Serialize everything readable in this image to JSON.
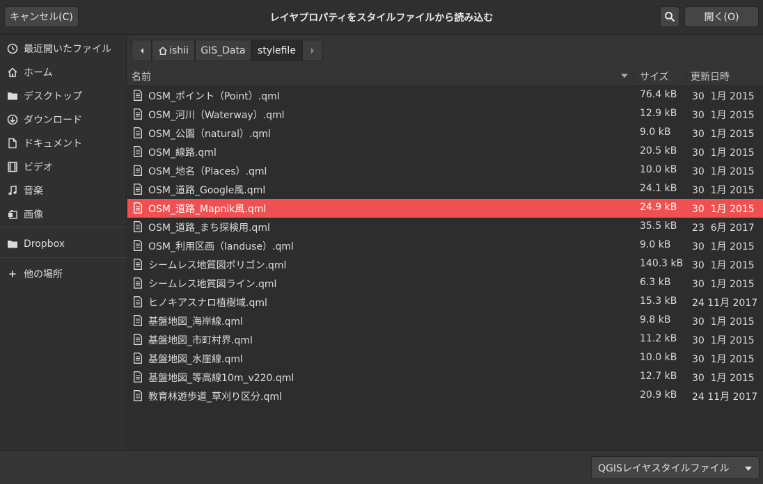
{
  "header": {
    "cancel_label": "キャンセル(C)",
    "title": "レイヤプロパティをスタイルファイルから読み込む",
    "open_label": "開く(O)"
  },
  "sidebar": {
    "items": [
      {
        "label": "最近開いたファイル",
        "icon": "recent-icon"
      },
      {
        "label": "ホーム",
        "icon": "home-icon"
      },
      {
        "label": "デスクトップ",
        "icon": "folder-icon"
      },
      {
        "label": "ダウンロード",
        "icon": "download-icon"
      },
      {
        "label": "ドキュメント",
        "icon": "document-icon"
      },
      {
        "label": "ビデオ",
        "icon": "video-icon"
      },
      {
        "label": "音楽",
        "icon": "music-icon"
      },
      {
        "label": "画像",
        "icon": "image-icon"
      },
      {
        "label": "Dropbox",
        "icon": "folder-icon"
      },
      {
        "label": "他の場所",
        "icon": "plus-icon"
      }
    ]
  },
  "pathbar": {
    "segments": [
      "ishii",
      "GIS_Data",
      "stylefile"
    ],
    "active": "stylefile"
  },
  "columns": {
    "name": "名前",
    "size": "サイズ",
    "modified": "更新日時"
  },
  "files": [
    {
      "name": "OSM_ポイント（Point）.qml",
      "size": "76.4 kB",
      "date": "30  1月 2015"
    },
    {
      "name": "OSM_河川（Waterway）.qml",
      "size": "12.9 kB",
      "date": "30  1月 2015"
    },
    {
      "name": "OSM_公園（natural）.qml",
      "size": "9.0 kB",
      "date": "30  1月 2015"
    },
    {
      "name": "OSM_線路.qml",
      "size": "20.5 kB",
      "date": "30  1月 2015"
    },
    {
      "name": "OSM_地名（Places）.qml",
      "size": "10.0 kB",
      "date": "30  1月 2015"
    },
    {
      "name": "OSM_道路_Google風.qml",
      "size": "24.1 kB",
      "date": "30  1月 2015"
    },
    {
      "name": "OSM_道路_Mapnik風.qml",
      "size": "24.9 kB",
      "date": "30  1月 2015",
      "selected": true
    },
    {
      "name": "OSM_道路_まち探検用.qml",
      "size": "35.5 kB",
      "date": "23  6月 2017"
    },
    {
      "name": "OSM_利用区画（landuse）.qml",
      "size": "9.0 kB",
      "date": "30  1月 2015"
    },
    {
      "name": "シームレス地質図ポリゴン.qml",
      "size": "140.3 kB",
      "date": "30  1月 2015"
    },
    {
      "name": "シームレス地質図ライン.qml",
      "size": "6.3 kB",
      "date": "30  1月 2015"
    },
    {
      "name": "ヒノキアスナロ植樹域.qml",
      "size": "15.3 kB",
      "date": "24 11月 2017"
    },
    {
      "name": "基盤地図_海岸線.qml",
      "size": "9.8 kB",
      "date": "30  1月 2015"
    },
    {
      "name": "基盤地図_市町村界.qml",
      "size": "11.2 kB",
      "date": "30  1月 2015"
    },
    {
      "name": "基盤地図_水崖線.qml",
      "size": "10.0 kB",
      "date": "30  1月 2015"
    },
    {
      "name": "基盤地図_等高線10m_v220.qml",
      "size": "12.7 kB",
      "date": "30  1月 2015"
    },
    {
      "name": "教育林遊歩道_草刈り区分.qml",
      "size": "20.9 kB",
      "date": "24 11月 2017"
    }
  ],
  "footer": {
    "filter_label": "QGISレイヤスタイルファイル"
  },
  "colors": {
    "selection": "#f05050",
    "background": "#353535"
  }
}
